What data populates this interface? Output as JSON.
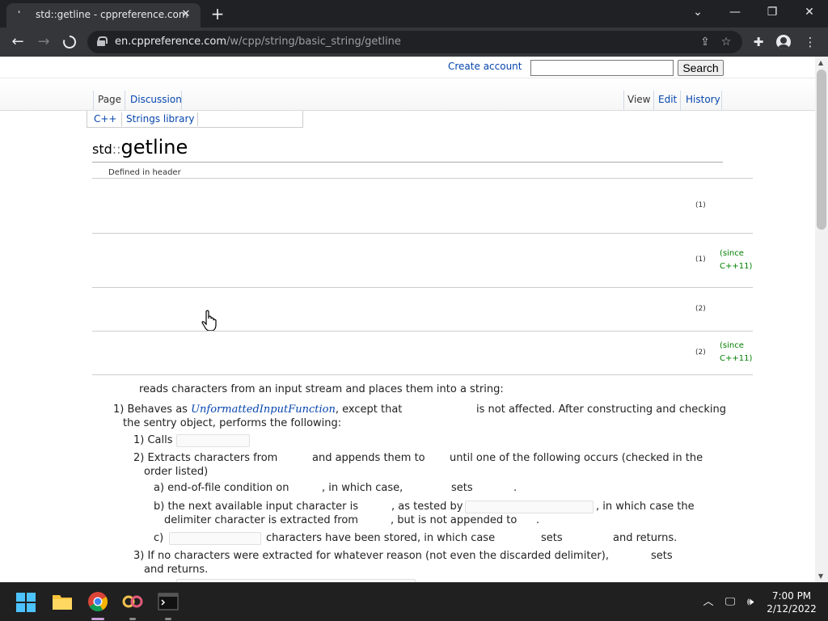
{
  "browser": {
    "tab_title": "std::getline - cppreference.com",
    "tab_close_glyph": "✕",
    "new_tab_glyph": "+",
    "url_host": "en.cppreference.com",
    "url_path": "/w/cpp/string/basic_string/getline"
  },
  "site": {
    "create_account": "Create account",
    "search_button": "Search",
    "tabs_left": [
      "Page",
      "Discussion"
    ],
    "tabs_right": [
      "View",
      "Edit",
      "History"
    ],
    "breadcrumb": [
      "C++",
      "Strings library"
    ]
  },
  "article": {
    "title_namespace": "std",
    "title_separator": "::",
    "title_name": "getline",
    "defined_in": "Defined in header",
    "declarations": [
      {
        "num": "(1)",
        "since": ""
      },
      {
        "num": "(1)",
        "since": "(since C++11)"
      },
      {
        "num": "(2)",
        "since": ""
      },
      {
        "num": "(2)",
        "since": "(since C++11)"
      }
    ],
    "intro": "reads characters from an input stream and places them into a string:",
    "p1_prefix": "1) Behaves as ",
    "p1_link": "UnformattedInputFunction",
    "p1_mid": ", except that",
    "p1_after": "is not affected. After constructing and checking",
    "p1_line2": "the sentry object, performs the following:",
    "s1": "1) Calls",
    "s2_a": "2) Extracts characters from",
    "s2_b": "and appends them to",
    "s2_c": "until one of the following occurs (checked in the",
    "s2_line2": "order listed)",
    "a_1": "a) end-of-file condition on",
    "a_2": ", in which case,",
    "a_3": "sets",
    "a_4": ".",
    "b_1": "b) the next available input character is",
    "b_2": ", as tested by",
    "b_3": ", in which case the",
    "b_4": "delimiter character is extracted from",
    "b_5": ", but is not appended to",
    "b_6": ".",
    "c_1": "c)",
    "c_2": "characters have been stored, in which case",
    "c_3": "sets",
    "c_4": "and returns.",
    "s3": "3) If no characters were extracted for whatever reason (not even the discarded delimiter),",
    "s3_b": "sets",
    "s3_line2": "and returns."
  },
  "taskbar": {
    "time": "7:00 PM",
    "date": "2/12/2022"
  }
}
